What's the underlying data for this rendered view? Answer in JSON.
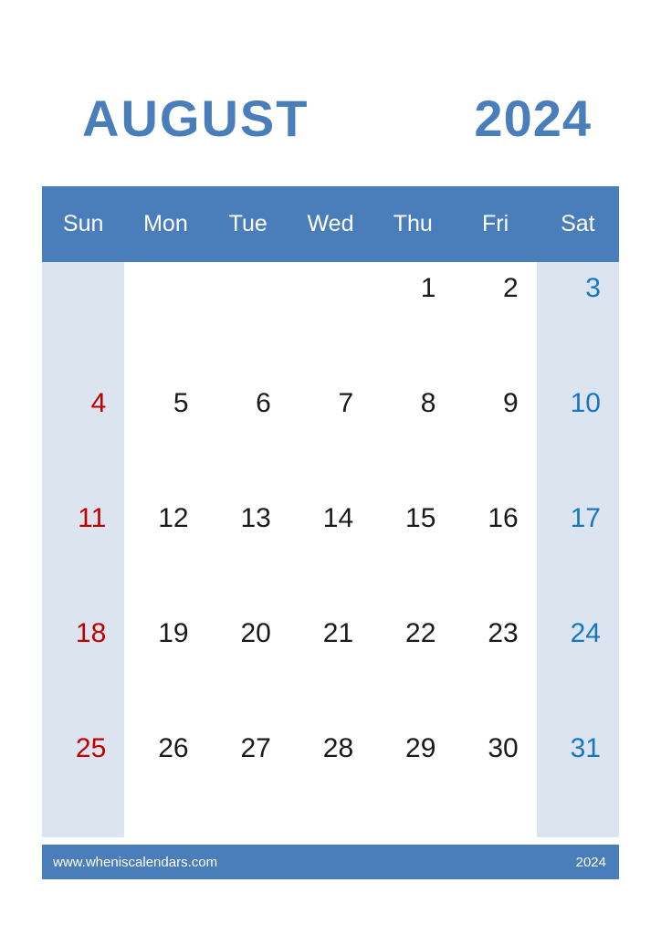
{
  "title": {
    "month": "AUGUST",
    "year": "2024"
  },
  "colors": {
    "header_blue": "#4A7EBB",
    "weekend_shade": "#DCE4F0",
    "sunday_text": "#C00000",
    "saturday_text": "#1477BF",
    "weekday_text": "#1A1A1A",
    "page_background": "#FFFFFF"
  },
  "weekdays": [
    {
      "label": "Sun",
      "type": "sunday"
    },
    {
      "label": "Mon",
      "type": "weekday"
    },
    {
      "label": "Tue",
      "type": "weekday"
    },
    {
      "label": "Wed",
      "type": "weekday"
    },
    {
      "label": "Thu",
      "type": "weekday"
    },
    {
      "label": "Fri",
      "type": "weekday"
    },
    {
      "label": "Sat",
      "type": "saturday"
    }
  ],
  "weeks": [
    {
      "days": [
        {
          "num": "",
          "kind": "empty"
        },
        {
          "num": "",
          "kind": "empty"
        },
        {
          "num": "",
          "kind": "empty"
        },
        {
          "num": "",
          "kind": "empty"
        },
        {
          "num": "1",
          "kind": "weekday"
        },
        {
          "num": "2",
          "kind": "weekday"
        },
        {
          "num": "3",
          "kind": "saturday"
        }
      ]
    },
    {
      "days": [
        {
          "num": "4",
          "kind": "sunday"
        },
        {
          "num": "5",
          "kind": "weekday"
        },
        {
          "num": "6",
          "kind": "weekday"
        },
        {
          "num": "7",
          "kind": "weekday"
        },
        {
          "num": "8",
          "kind": "weekday"
        },
        {
          "num": "9",
          "kind": "weekday"
        },
        {
          "num": "10",
          "kind": "saturday"
        }
      ]
    },
    {
      "days": [
        {
          "num": "11",
          "kind": "sunday"
        },
        {
          "num": "12",
          "kind": "weekday"
        },
        {
          "num": "13",
          "kind": "weekday"
        },
        {
          "num": "14",
          "kind": "weekday"
        },
        {
          "num": "15",
          "kind": "weekday"
        },
        {
          "num": "16",
          "kind": "weekday"
        },
        {
          "num": "17",
          "kind": "saturday"
        }
      ]
    },
    {
      "days": [
        {
          "num": "18",
          "kind": "sunday"
        },
        {
          "num": "19",
          "kind": "weekday"
        },
        {
          "num": "20",
          "kind": "weekday"
        },
        {
          "num": "21",
          "kind": "weekday"
        },
        {
          "num": "22",
          "kind": "weekday"
        },
        {
          "num": "23",
          "kind": "weekday"
        },
        {
          "num": "24",
          "kind": "saturday"
        }
      ]
    },
    {
      "days": [
        {
          "num": "25",
          "kind": "sunday"
        },
        {
          "num": "26",
          "kind": "weekday"
        },
        {
          "num": "27",
          "kind": "weekday"
        },
        {
          "num": "28",
          "kind": "weekday"
        },
        {
          "num": "29",
          "kind": "weekday"
        },
        {
          "num": "30",
          "kind": "weekday"
        },
        {
          "num": "31",
          "kind": "saturday"
        }
      ]
    }
  ],
  "footer": {
    "site": "www.wheniscalendars.com",
    "year": "2024"
  }
}
